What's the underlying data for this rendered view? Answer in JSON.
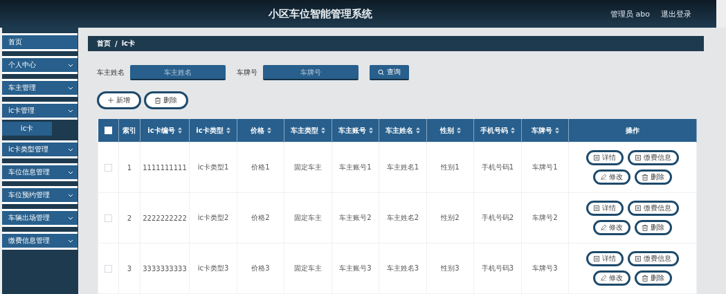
{
  "header": {
    "title": "小区车位智能管理系统",
    "user": "管理员 abo",
    "logout": "退出登录"
  },
  "sidebar": {
    "items": [
      {
        "label": "首页",
        "expandable": false,
        "selected": false
      },
      {
        "label": "个人中心",
        "expandable": true,
        "selected": false
      },
      {
        "label": "车主管理",
        "expandable": true,
        "selected": false
      },
      {
        "label": "ic卡管理",
        "expandable": true,
        "selected": false,
        "children": [
          {
            "label": "ic卡",
            "selected": true
          }
        ]
      },
      {
        "label": "ic卡类型管理",
        "expandable": true,
        "selected": false
      },
      {
        "label": "车位信息管理",
        "expandable": true,
        "selected": false
      },
      {
        "label": "车位预约管理",
        "expandable": true,
        "selected": false
      },
      {
        "label": "车辆出场管理",
        "expandable": true,
        "selected": false
      },
      {
        "label": "缴费信息管理",
        "expandable": true,
        "selected": false
      }
    ]
  },
  "breadcrumb": [
    "首页",
    "ic卡"
  ],
  "breadcrumb_separator": "/",
  "search": {
    "fields": [
      {
        "label": "车主姓名",
        "placeholder": "车主姓名"
      },
      {
        "label": "车牌号",
        "placeholder": "车牌号"
      }
    ],
    "button": "查询"
  },
  "actions": [
    {
      "kind": "add",
      "label": "新增"
    },
    {
      "kind": "delete",
      "label": "删除"
    }
  ],
  "table": {
    "all_checked": false,
    "columns": [
      {
        "label": "索引",
        "sortable": false
      },
      {
        "label": "ic卡编号",
        "sortable": true
      },
      {
        "label": "ic卡类型",
        "sortable": true
      },
      {
        "label": "价格",
        "sortable": true
      },
      {
        "label": "车主类型",
        "sortable": true
      },
      {
        "label": "车主账号",
        "sortable": true
      },
      {
        "label": "车主姓名",
        "sortable": true
      },
      {
        "label": "性别",
        "sortable": true
      },
      {
        "label": "手机号码",
        "sortable": true
      },
      {
        "label": "车牌号",
        "sortable": true
      },
      {
        "label": "操作",
        "sortable": false
      }
    ],
    "rows": [
      {
        "checked": false,
        "cells": [
          "1",
          "1111111111",
          "ic卡类型1",
          "价格1",
          "固定车主",
          "车主账号1",
          "车主姓名1",
          "性别1",
          "手机号码1",
          "车牌号1"
        ],
        "actions": [
          {
            "kind": "detail",
            "label": "详情"
          },
          {
            "kind": "payment",
            "label": "缴费信息"
          },
          {
            "kind": "edit",
            "label": "修改"
          },
          {
            "kind": "delete",
            "label": "删除"
          }
        ]
      },
      {
        "checked": false,
        "cells": [
          "2",
          "2222222222",
          "ic卡类型2",
          "价格2",
          "固定车主",
          "车主账号2",
          "车主姓名2",
          "性别2",
          "手机号码2",
          "车牌号2"
        ],
        "actions": [
          {
            "kind": "detail",
            "label": "详情"
          },
          {
            "kind": "payment",
            "label": "缴费信息"
          },
          {
            "kind": "edit",
            "label": "修改"
          },
          {
            "kind": "delete",
            "label": "删除"
          }
        ]
      },
      {
        "checked": false,
        "cells": [
          "3",
          "3333333333",
          "ic卡类型3",
          "价格3",
          "固定车主",
          "车主账号3",
          "车主姓名3",
          "性别3",
          "手机号码3",
          "车牌号3"
        ],
        "actions": [
          {
            "kind": "detail",
            "label": "详情"
          },
          {
            "kind": "payment",
            "label": "缴费信息"
          },
          {
            "kind": "edit",
            "label": "修改"
          },
          {
            "kind": "delete",
            "label": "删除"
          }
        ]
      }
    ]
  }
}
